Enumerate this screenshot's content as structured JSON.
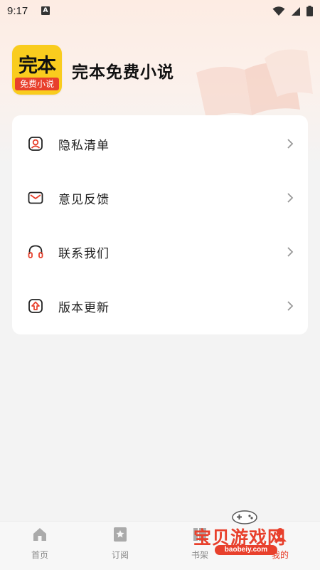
{
  "status_bar": {
    "time": "9:17",
    "notification_glyph": "A"
  },
  "app": {
    "logo_main_text": "完本",
    "logo_band_text": "免费小说",
    "name": "完本免费小说"
  },
  "menu": [
    {
      "label": "隐私清单",
      "icon": "privacy-icon"
    },
    {
      "label": "意见反馈",
      "icon": "mail-icon"
    },
    {
      "label": "联系我们",
      "icon": "headset-icon"
    },
    {
      "label": "版本更新",
      "icon": "update-icon"
    }
  ],
  "bottom_nav": [
    {
      "label": "首页",
      "icon": "home-icon"
    },
    {
      "label": "订阅",
      "icon": "bookmark-star-icon"
    },
    {
      "label": "书架",
      "icon": "bookshelf-icon"
    },
    {
      "label": "我的",
      "icon": "profile-icon"
    }
  ],
  "watermark": {
    "text": "宝贝游戏网",
    "url": "baobeiy.com"
  },
  "colors": {
    "accent": "#e8402c",
    "logo_yellow": "#f9cc1e",
    "background": "#f3f3f3"
  }
}
